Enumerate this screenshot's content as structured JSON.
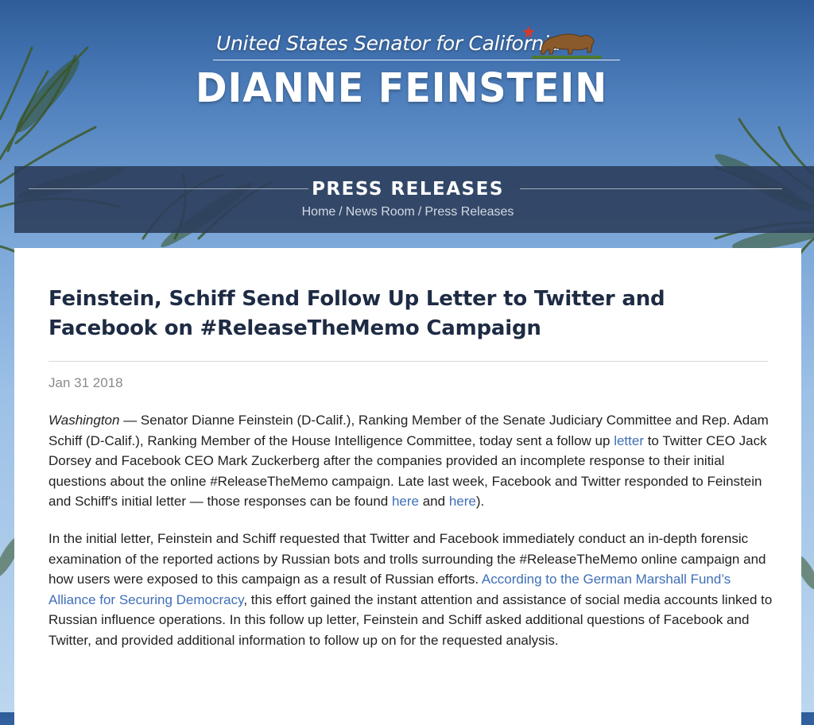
{
  "header": {
    "subtitle": "United States Senator for California",
    "name": "DIANNE FEINSTEIN",
    "logo": "california-bear-flag-icon"
  },
  "banner": {
    "title": "PRESS RELEASES",
    "breadcrumb": [
      "Home",
      "News Room",
      "Press Releases"
    ],
    "separator": "/"
  },
  "article": {
    "title": "Feinstein, Schiff Send Follow Up Letter to Twitter and Facebook on #ReleaseTheMemo Campaign",
    "date": "Jan 31 2018",
    "p1": {
      "dateline": "Washington",
      "t1": " — Senator Dianne Feinstein (D-Calif.), Ranking Member of the Senate Judiciary Committee and Rep. Adam Schiff (D-Calif.), Ranking Member of the House Intelligence Committee, today sent a follow up ",
      "link_letter": "letter",
      "t2": " to Twitter CEO Jack Dorsey and Facebook CEO Mark Zuckerberg after the companies provided an incomplete response to their initial questions about the online #ReleaseTheMemo campaign. Late last week, Facebook and Twitter responded to Feinstein and Schiff's initial letter — those responses can be found ",
      "link_here1": "here",
      "t3": " and ",
      "link_here2": "here",
      "t4": ")."
    },
    "p2": {
      "t1": "In the initial letter, Feinstein and Schiff requested that Twitter and Facebook immediately conduct an in-depth forensic examination of the reported actions by Russian bots and trolls surrounding the #ReleaseTheMemo online campaign and how users were exposed to this campaign as a result of Russian efforts.  ",
      "link_gmf": "According to the German Marshall Fund’s Alliance for Securing Democracy",
      "t2": ", this effort gained the instant attention and assistance of social media accounts linked to Russian influence operations. In this follow up letter, Feinstein and Schiff asked additional questions of Facebook and Twitter, and provided additional information to follow up on for the requested analysis."
    }
  },
  "colors": {
    "banner_bg": "#2c3e5c",
    "title": "#1e2b44",
    "link": "#3f6fb8",
    "date": "#8a8a8a"
  }
}
